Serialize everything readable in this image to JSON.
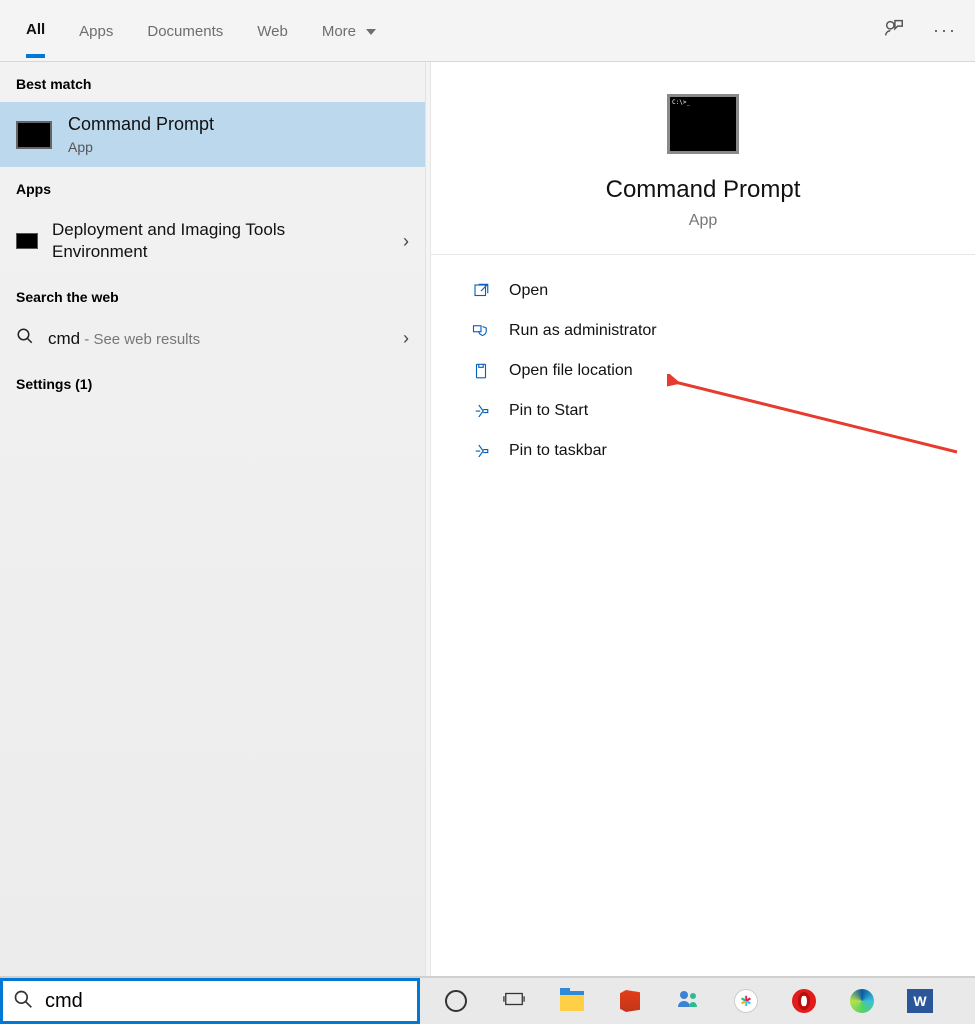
{
  "tabs": {
    "all": "All",
    "apps": "Apps",
    "documents": "Documents",
    "web": "Web",
    "more": "More"
  },
  "left": {
    "best_match_heading": "Best match",
    "best_match": {
      "title": "Command Prompt",
      "subtitle": "App"
    },
    "apps_heading": "Apps",
    "app_row": {
      "title_line1": "Deployment and Imaging Tools",
      "title_line2": "Environment"
    },
    "web_heading": "Search the web",
    "web_row": {
      "query": "cmd",
      "suffix": " - See web results"
    },
    "settings_heading": "Settings (1)"
  },
  "preview": {
    "title": "Command Prompt",
    "subtitle": "App",
    "actions": {
      "open": "Open",
      "run_admin": "Run as administrator",
      "open_location": "Open file location",
      "pin_start": "Pin to Start",
      "pin_taskbar": "Pin to taskbar"
    }
  },
  "search": {
    "value": "cmd"
  },
  "taskbar": {
    "word_letter": "W"
  }
}
